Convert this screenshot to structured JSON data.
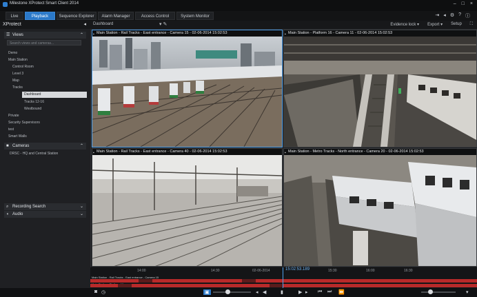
{
  "window": {
    "title": "Milestone XProtect Smart Client 2014",
    "controls": [
      "–",
      "□",
      "×"
    ]
  },
  "menu": {
    "tabs": [
      {
        "label": "Live",
        "active": false
      },
      {
        "label": "Playback",
        "active": true
      },
      {
        "label": "Sequence Explorer",
        "active": false
      },
      {
        "label": "Alarm Manager",
        "active": false
      },
      {
        "label": "Access Control",
        "active": false
      },
      {
        "label": "System Monitor",
        "active": false
      }
    ],
    "right_icons": [
      "exit-icon",
      "left-arrow-icon",
      "gear-icon",
      "help-icon",
      "info-icon"
    ]
  },
  "sidebar": {
    "brand": "XProtect",
    "views_label": "Views",
    "search_placeholder": "Search views and cameras...",
    "tree": [
      "Demo",
      "Main Station",
      "Control Room",
      "Level 3",
      "Map",
      "Tracks",
      "Dashboard",
      "Tracks 12-16",
      "Westbound",
      "Private",
      "Security Supervisors",
      "test",
      "Smart Walls"
    ],
    "selected_item": "Dashboard",
    "cameras_label": "Cameras",
    "camera_item": "DRSC - HQ and Central Station",
    "recording_search_label": "Recording Search",
    "audio_label": "Audio"
  },
  "toolbar": {
    "left_label": "Dashboard",
    "right_items": [
      "Evidence lock ▾",
      "Export ▾",
      "Setup"
    ]
  },
  "views": [
    {
      "title": "Main Station - Rail Tracks - East entrance - Camera 15 - 02-06-2014 15:02:53",
      "active": true
    },
    {
      "title": "Main Station - Platform 16 - Camera 11 - 02-06-2014 15:02:53",
      "active": false
    },
    {
      "title": "Main Station - Rail Tracks - East entrance - Camera 40 - 02-06-2014 15:02:53",
      "active": false
    },
    {
      "title": "Main Station - Metro Tracks - North entrance - Camera 20 - 02-06-2014 15:02:53",
      "active": false
    }
  ],
  "timeline": {
    "current_time": "15:02:53.189",
    "ticks": [
      "14:00",
      "14:30",
      "02-06-2014",
      "15:30",
      "16:00",
      "16:30"
    ],
    "track_labels": [
      "Main Station - Rail Tracks - East entrance - Camera 15",
      "Main Station - Platform 16"
    ]
  },
  "colors": {
    "accent": "#2b79c9",
    "recording": "#b82a2a",
    "playhead": "#4ea0ee"
  }
}
